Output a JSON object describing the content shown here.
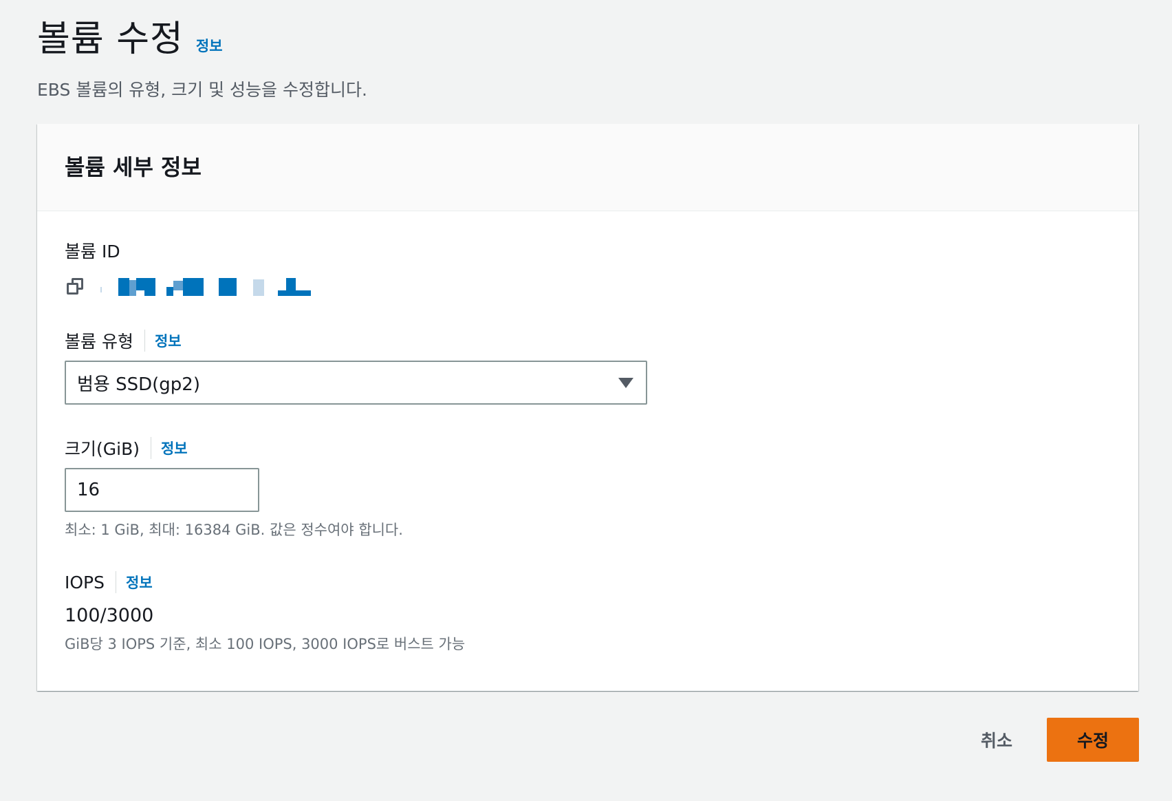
{
  "page": {
    "title": "볼륨 수정",
    "title_info": "정보",
    "description": "EBS 볼륨의 유형, 크기 및 성능을 수정합니다."
  },
  "panel": {
    "title": "볼륨 세부 정보",
    "volume_id": {
      "label": "볼륨 ID",
      "copy_icon": "copy-icon"
    },
    "volume_type": {
      "label": "볼륨 유형",
      "info": "정보",
      "value": "범용 SSD(gp2)",
      "caret_icon": "caret-down-icon"
    },
    "size": {
      "label": "크기(GiB)",
      "info": "정보",
      "value": "16",
      "hint": "최소: 1 GiB, 최대: 16384 GiB. 값은 정수여야 합니다."
    },
    "iops": {
      "label": "IOPS",
      "info": "정보",
      "value": "100/3000",
      "hint": "GiB당 3 IOPS 기준, 최소 100 IOPS, 3000 IOPS로 버스트 가능"
    }
  },
  "actions": {
    "cancel": "취소",
    "submit": "수정"
  },
  "colors": {
    "primary": "#ec7211",
    "link": "#0073bb",
    "background": "#f2f3f3",
    "redaction": "#0073bb"
  }
}
